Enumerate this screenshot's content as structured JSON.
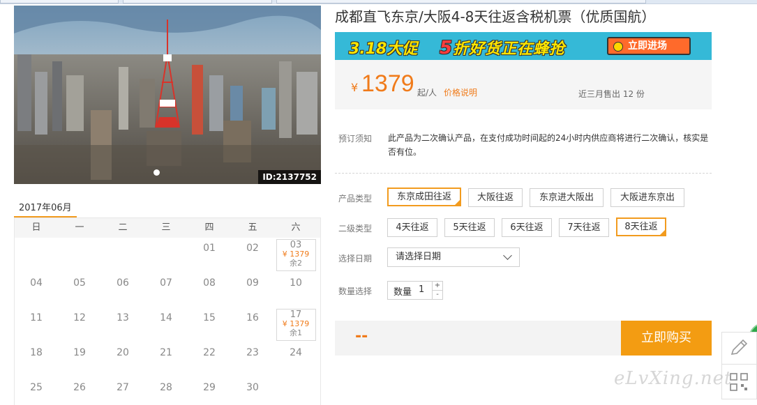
{
  "photo": {
    "id_label": "ID:2137752"
  },
  "calendar": {
    "month": "2017年06月",
    "weekdays": [
      "日",
      "一",
      "二",
      "三",
      "四",
      "五",
      "六"
    ],
    "weeks": [
      [
        {
          "d": ""
        },
        {
          "d": ""
        },
        {
          "d": ""
        },
        {
          "d": ""
        },
        {
          "d": "01"
        },
        {
          "d": "02"
        },
        {
          "d": "03",
          "price": "¥ 1379",
          "remain": "余2"
        }
      ],
      [
        {
          "d": "04"
        },
        {
          "d": "05"
        },
        {
          "d": "06"
        },
        {
          "d": "07"
        },
        {
          "d": "08"
        },
        {
          "d": "09"
        },
        {
          "d": "10"
        }
      ],
      [
        {
          "d": "11"
        },
        {
          "d": "12"
        },
        {
          "d": "13"
        },
        {
          "d": "14"
        },
        {
          "d": "15"
        },
        {
          "d": "16"
        },
        {
          "d": "17",
          "price": "¥ 1379",
          "remain": "余1"
        }
      ],
      [
        {
          "d": "18"
        },
        {
          "d": "19"
        },
        {
          "d": "20"
        },
        {
          "d": "21"
        },
        {
          "d": "22"
        },
        {
          "d": "23"
        },
        {
          "d": "24"
        }
      ],
      [
        {
          "d": "25"
        },
        {
          "d": "26"
        },
        {
          "d": "27"
        },
        {
          "d": "28"
        },
        {
          "d": "29"
        },
        {
          "d": "30"
        },
        {
          "d": ""
        }
      ]
    ]
  },
  "product": {
    "title": "成都直飞东京/大阪4-8天往返含税机票（优质国航）",
    "banner": {
      "promo": "3.18大促",
      "five": "5",
      "slogan": "折好货正在蜂抢",
      "cta": "立即进场"
    },
    "price": {
      "currency": "¥",
      "value": "1379",
      "unit": "起/人",
      "note": "价格说明",
      "sold": "近三月售出 12 份"
    },
    "notice": {
      "label": "预订须知",
      "text": "此产品为二次确认产品，在支付成功时间起的24小时内供应商将进行二次确认，核实是否有位。"
    },
    "product_type": {
      "label": "产品类型",
      "options": [
        "东京成田往返",
        "大阪往返",
        "东京进大阪出",
        "大阪进东京出"
      ],
      "selected": "东京成田往返"
    },
    "sub_type": {
      "label": "二级类型",
      "options": [
        "4天往返",
        "5天往返",
        "6天往返",
        "7天往返",
        "8天往返"
      ],
      "selected": "8天往返"
    },
    "date": {
      "label": "选择日期",
      "placeholder": "请选择日期"
    },
    "quantity": {
      "label": "数量选择",
      "field_label": "数量",
      "value": "1",
      "plus": "+",
      "minus": "-"
    },
    "total": "--",
    "buy_label": "立即购买"
  },
  "watermark": "eLvXing.net",
  "colors": {
    "accent": "#f29b1e",
    "price": "#f07b1a",
    "buy": "#f39c12",
    "banner": "#35b9d7"
  }
}
